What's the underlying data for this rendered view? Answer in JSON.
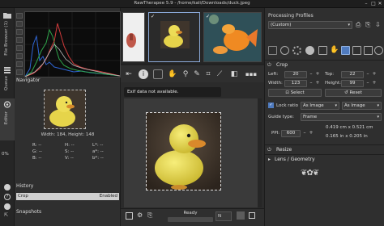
{
  "window": {
    "title": "RawTherapee 5.9 - /home/kali/Downloads/duck.jpeg"
  },
  "left_tabs": [
    {
      "label": "File Browser (1)"
    },
    {
      "label": "Queue"
    },
    {
      "label": "Editor"
    }
  ],
  "left_misc": {
    "percent": "0%"
  },
  "navigator": {
    "title": "Navigator",
    "dimensions": "Width: 184, Height: 148",
    "channels": [
      {
        "label": "R:",
        "value": "--"
      },
      {
        "label": "G:",
        "value": "--"
      },
      {
        "label": "B:",
        "value": "--"
      },
      {
        "label": "H:",
        "value": "--"
      },
      {
        "label": "S:",
        "value": "--"
      },
      {
        "label": "V:",
        "value": "--"
      },
      {
        "label": "L*:",
        "value": "--"
      },
      {
        "label": "a*:",
        "value": "--"
      },
      {
        "label": "b*:",
        "value": "--"
      }
    ]
  },
  "history": {
    "title": "History",
    "row_label": "Crop",
    "row_value": "Enabled"
  },
  "snapshots": {
    "title": "Snapshots"
  },
  "center": {
    "tooltip": "Exif data not available.",
    "status": "Ready",
    "zoom_label": "N"
  },
  "right": {
    "profiles_title": "Processing Profiles",
    "profile_value": "(Custom)",
    "crop": {
      "title": "Crop",
      "left_label": "Left:",
      "left_value": "20",
      "top_label": "Top:",
      "top_value": "22",
      "width_label": "Width:",
      "width_value": "123",
      "height_label": "Height:",
      "height_value": "99",
      "select_label": "Select",
      "reset_label": "Reset",
      "lock_label": "Lock ratio",
      "ratio_value": "As Image",
      "orientation_value": "As Image",
      "guide_label": "Guide type:",
      "guide_value": "Frame",
      "ppi_label": "PPI:",
      "ppi_value": "600",
      "size_cm": "0.419 cm x 0.521 cm",
      "size_in": "0.165 in x 0.205 in"
    },
    "resize_title": "Resize",
    "lens_title": "Lens / Geometry"
  },
  "colors": {
    "accent": "#4f7bbf",
    "title_bar": "#1e1e1e",
    "panel": "#2f2f2f"
  }
}
